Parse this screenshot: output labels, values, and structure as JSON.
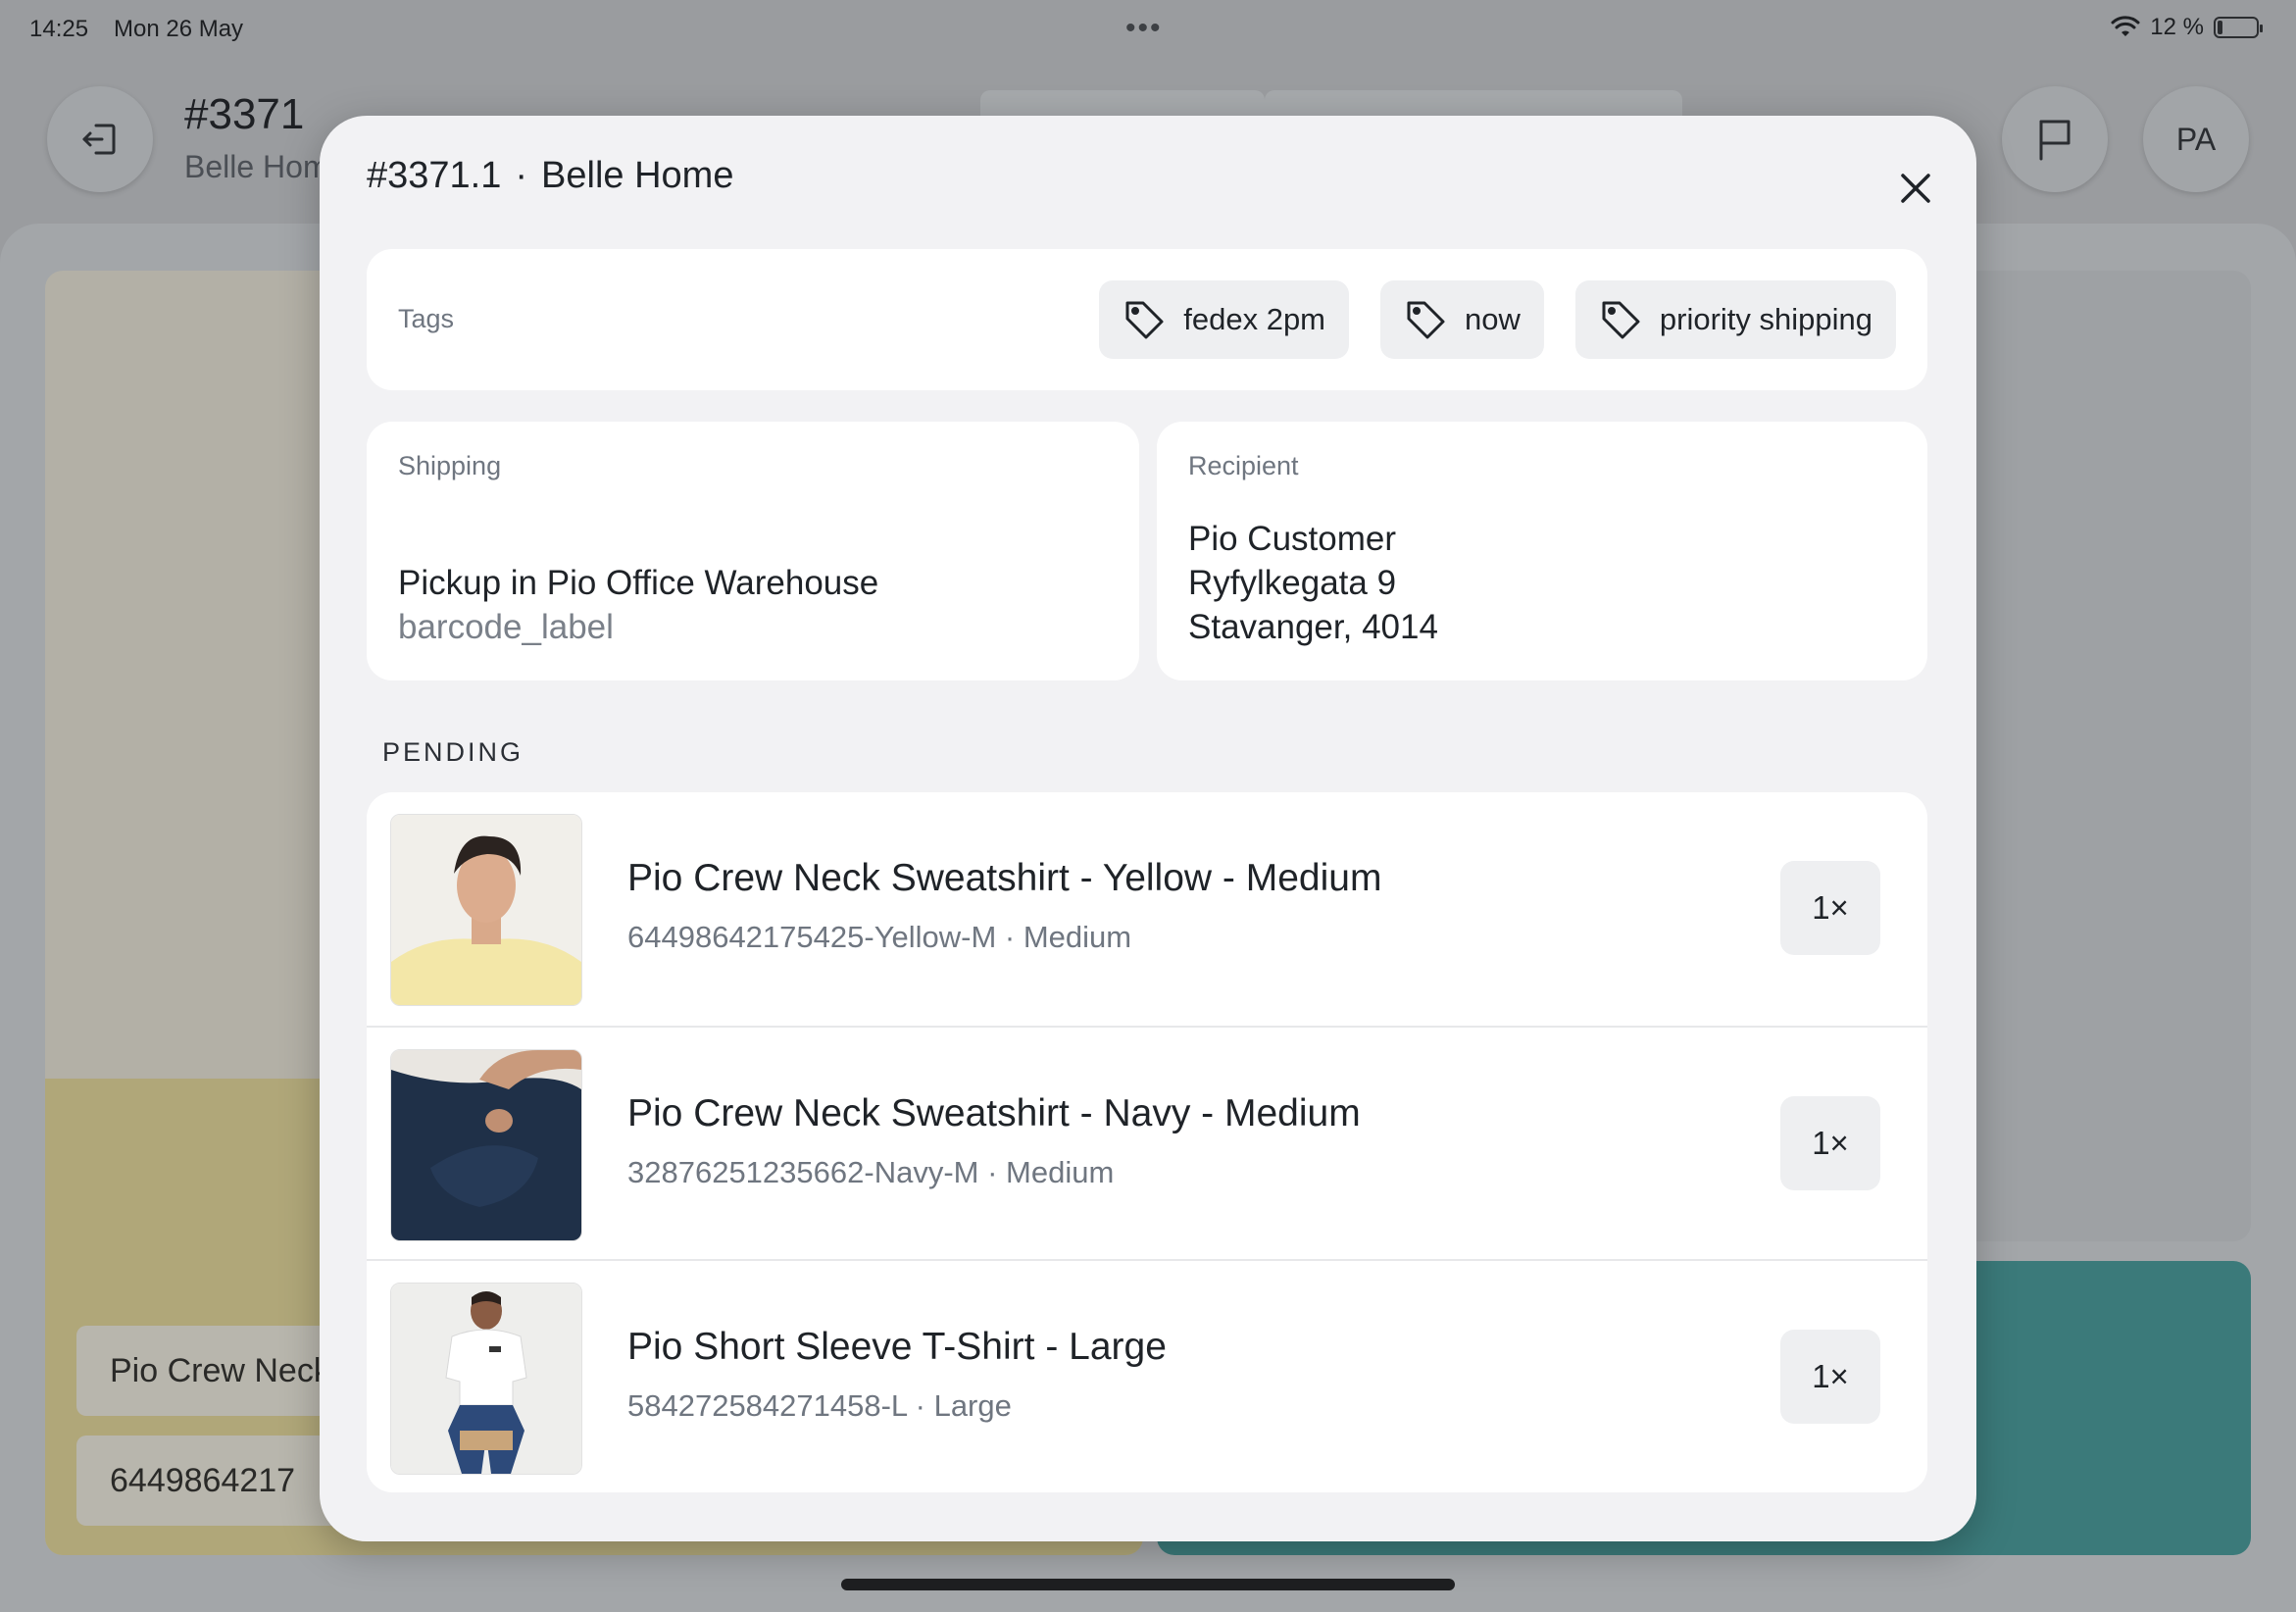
{
  "statusbar": {
    "time": "14:25",
    "date": "Mon 26 May",
    "battery": "12 %",
    "battery_level": 0.12
  },
  "background": {
    "order_number": "#3371",
    "order_store": "Belle Hom",
    "avatar_initials": "PA",
    "field_name": "Pio Crew Neck",
    "field_sku": "6449864217"
  },
  "modal": {
    "title_order": "#3371.1",
    "title_separator": "·",
    "title_store": "Belle Home",
    "tags": {
      "label": "Tags",
      "items": [
        "fedex 2pm",
        "now",
        "priority shipping"
      ]
    },
    "shipping": {
      "label": "Shipping",
      "method": "Pickup in Pio Office Warehouse",
      "label_type": "barcode_label"
    },
    "recipient": {
      "label": "Recipient",
      "name": "Pio Customer",
      "street": "Ryfylkegata 9",
      "city": "Stavanger, 4014"
    },
    "section_label": "PENDING",
    "items": [
      {
        "name": "Pio Crew Neck Sweatshirt - Yellow - Medium",
        "sku": "64498642175425-Yellow-M · Medium",
        "qty": "1×"
      },
      {
        "name": "Pio Crew Neck Sweatshirt - Navy - Medium",
        "sku": "32876251235662-Navy-M · Medium",
        "qty": "1×"
      },
      {
        "name": "Pio Short Sleeve T-Shirt - Large",
        "sku": "584272584271458-L · Large",
        "qty": "1×"
      }
    ]
  }
}
